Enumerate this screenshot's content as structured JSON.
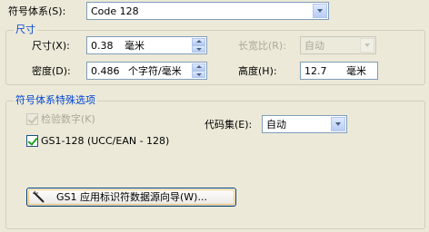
{
  "symbology": {
    "label": "符号体系(S):",
    "value": "Code 128"
  },
  "size_group": {
    "title": "尺寸",
    "size_label": "尺寸(X):",
    "size_value": "0.38",
    "size_unit": "毫米",
    "density_label": "密度(D):",
    "density_value": "0.486",
    "density_unit": "个字符/毫米",
    "ratio_label": "长宽比(R):",
    "ratio_value": "自动",
    "height_label": "高度(H):",
    "height_value": "12.7",
    "height_unit": "毫米"
  },
  "special_group": {
    "title": "符号体系特殊选项",
    "checkdigit_label": "检验数字(K)",
    "codeset_label": "代码集(E):",
    "codeset_value": "自动",
    "gs1_label": "GS1-128 (UCC/EAN - 128)",
    "wizard_button": "GS1 应用标识符数据源向导(W)..."
  }
}
